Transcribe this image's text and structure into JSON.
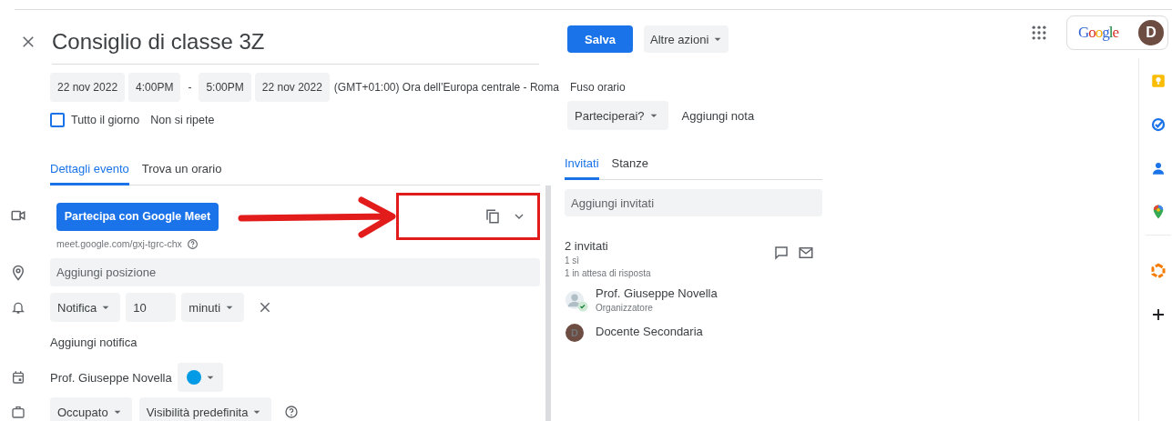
{
  "header": {
    "title": "Consiglio di classe 3Z",
    "save": "Salva",
    "more_actions": "Altre azioni",
    "logo": "Google",
    "account_initial": "D"
  },
  "when": {
    "start_date": "22 nov 2022",
    "start_time": "4:00PM",
    "separator": "-",
    "end_time": "5:00PM",
    "end_date": "22 nov 2022",
    "timezone": "(GMT+01:00) Ora dell’Europa centrale - Roma",
    "timezone_link": "Fuso orario",
    "all_day": {
      "label": "Tutto il giorno",
      "checked": false
    },
    "repeat": "Non si ripete"
  },
  "left_tabs": [
    {
      "label": "Dettagli evento",
      "selected": true
    },
    {
      "label": "Trova un orario",
      "selected": false
    }
  ],
  "details": {
    "meet_button": "Partecipa con Google Meet",
    "meet_url": "meet.google.com/gxj-tgrc-chx",
    "location_placeholder": "Aggiungi posizione",
    "notification": {
      "type": "Notifica",
      "amount": "10",
      "unit": "minuti"
    },
    "add_notification": "Aggiungi notifica",
    "calendar": {
      "owner": "Prof. Giuseppe Novella",
      "color": "#039be5"
    },
    "availability": "Occupato",
    "visibility": "Visibilità predefinita"
  },
  "rsvp": {
    "question": "Parteciperai?",
    "add_note": "Aggiungi nota"
  },
  "right_tabs": [
    {
      "label": "Invitati",
      "selected": true
    },
    {
      "label": "Stanze",
      "selected": false
    }
  ],
  "guests": {
    "placeholder": "Aggiungi invitati",
    "count": "2 invitati",
    "yes": "1 sì",
    "pending": "1 in attesa di risposta",
    "list": [
      {
        "name": "Prof. Giuseppe Novella",
        "role": "Organizzatore",
        "kind": "photo",
        "accepted": true
      },
      {
        "name": "Docente Secondaria",
        "kind": "letter",
        "initial": "D",
        "accepted": false
      }
    ]
  },
  "annotation": {
    "shown": true
  }
}
